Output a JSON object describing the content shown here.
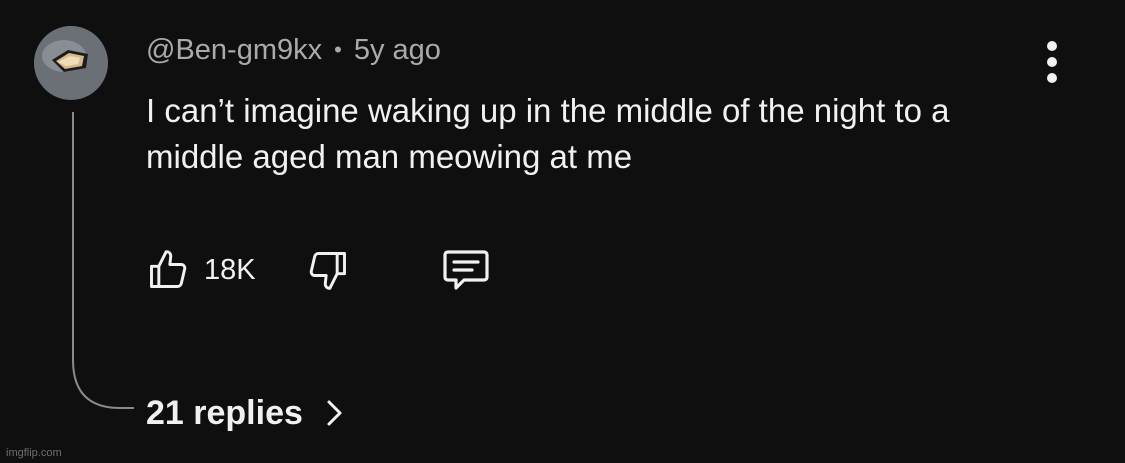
{
  "comment": {
    "author": "@Ben-gm9kx",
    "separator": "•",
    "time": "5y ago",
    "text": "I can’t imagine waking up in the middle of the night to a middle aged man meowing at me",
    "likes": "18K",
    "replies_label": "21 replies"
  },
  "watermark": "imgflip.com",
  "icons": {
    "like": "thumbs-up-icon",
    "dislike": "thumbs-down-icon",
    "reply": "comment-bubble-icon",
    "menu": "more-vertical-icon",
    "expand": "chevron-right-icon"
  },
  "colors": {
    "background": "#0f0f0f",
    "text": "#f1f1f1",
    "meta": "#aaaaaa"
  }
}
